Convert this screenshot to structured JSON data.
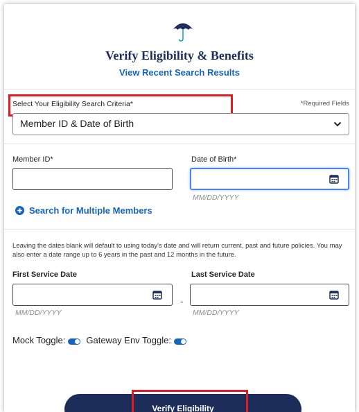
{
  "header": {
    "title": "Verify Eligibility & Benefits",
    "recent_link": "View Recent Search Results"
  },
  "criteria": {
    "label": "Select Your Eligibility Search Criteria*",
    "required_note": "*Required Fields",
    "selected": "Member ID & Date of Birth"
  },
  "member": {
    "member_id_label": "Member ID*",
    "member_id_value": "",
    "dob_label": "Date of Birth*",
    "dob_value": "",
    "dob_hint": "MM/DD/YYYY"
  },
  "multi_link": "Search for Multiple Members",
  "info_text": "Leaving the dates blank will default to using today's date and will return current, past and future policies. You may also enter a date range up to 6 years in the past and 12 months in the future.",
  "service_dates": {
    "first_label": "First Service Date",
    "first_hint": "MM/DD/YYYY",
    "separator": "-",
    "last_label": "Last Service Date",
    "last_hint": "MM/DD/YYYY"
  },
  "toggles": {
    "mock_label": "Mock Toggle:",
    "gateway_label": "Gateway Env Toggle:"
  },
  "verify_button": "Verify Eligibility",
  "colors": {
    "brand_navy": "#1c2d5a",
    "link_blue": "#1565c0",
    "highlight_red": "#e01b24",
    "logo_teal": "#1ba6b8"
  }
}
